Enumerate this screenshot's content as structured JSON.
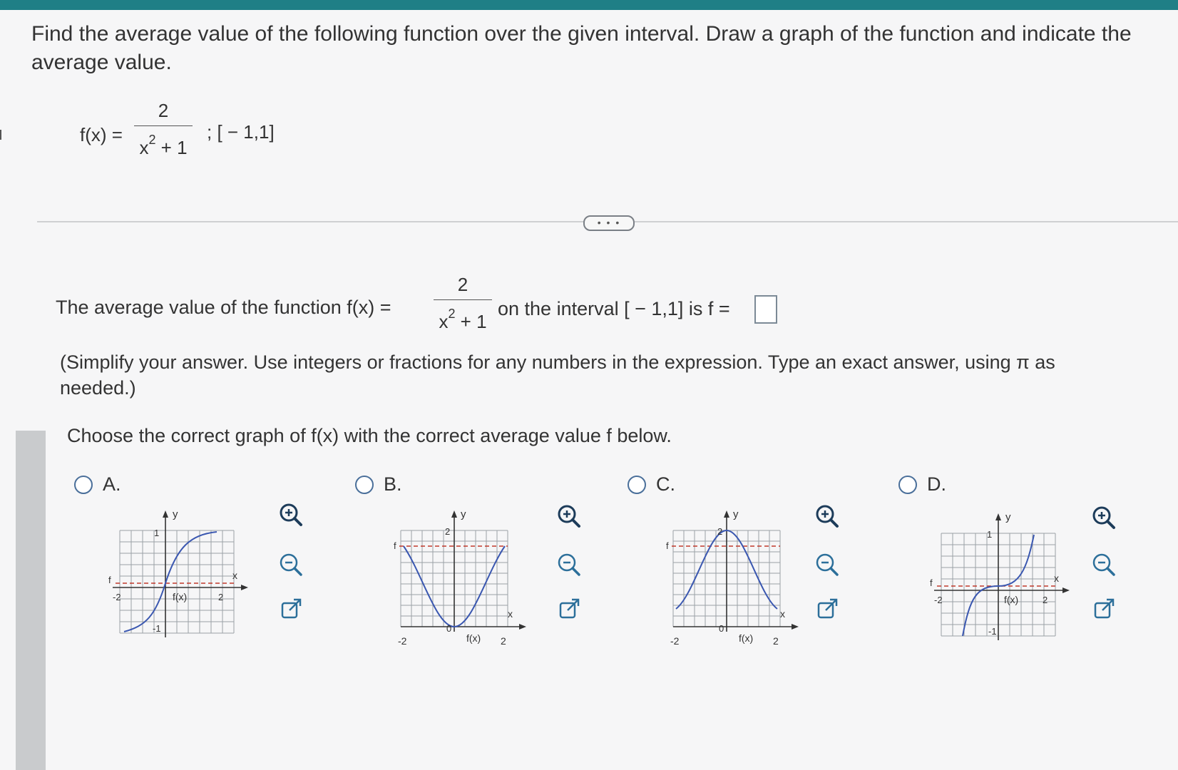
{
  "question": {
    "prompt": "Find the average value of the following function over the given interval. Draw a graph of the function and indicate the average value.",
    "function_lhs": "f(x) =",
    "numerator": "2",
    "denominator_base": "x",
    "denominator_exp": "2",
    "denominator_rest": " + 1",
    "interval": "; [ − 1,1]"
  },
  "more_button": "• • •",
  "answer": {
    "prefix": "The average value of the function f(x) =",
    "suffix": "on the interval [ − 1,1] is f =",
    "value": "",
    "hint": "(Simplify your answer. Use integers or fractions for any numbers in the expression. Type an exact answer, using π as needed.)"
  },
  "choose": "Choose the correct graph of f(x) with the correct average value f below.",
  "options": [
    {
      "letter": "A.",
      "labels": {
        "y": "y",
        "x": "x",
        "f": "f",
        "fx": "f(x)",
        "xmin": "-2",
        "xmax": "2",
        "ytop": "1",
        "ybot": "-1"
      }
    },
    {
      "letter": "B.",
      "labels": {
        "y": "y",
        "x": "x",
        "f": "f",
        "fx": "f(x)",
        "xmin": "-2",
        "xmax": "2",
        "ytop": "2",
        "zero": "0"
      }
    },
    {
      "letter": "C.",
      "labels": {
        "y": "y",
        "x": "x",
        "f": "f",
        "fx": "f(x)",
        "xmin": "-2",
        "xmax": "2",
        "ytop": "2",
        "zero": "0"
      }
    },
    {
      "letter": "D.",
      "labels": {
        "y": "y",
        "x": "x",
        "f": "f",
        "fx": "f(x)",
        "xmin": "-2",
        "xmax": "2",
        "ytop": "1",
        "ybot": "-1"
      }
    }
  ],
  "icons": {
    "zoom_in": "zoom-in-icon",
    "zoom_out": "zoom-out-icon",
    "open": "open-new-window-icon"
  },
  "colors": {
    "curve": "#3a57b0",
    "avg_line": "#c0392b",
    "grid": "#9aa0a6",
    "radio": "#4a6f9a",
    "header": "#1f7f86"
  }
}
